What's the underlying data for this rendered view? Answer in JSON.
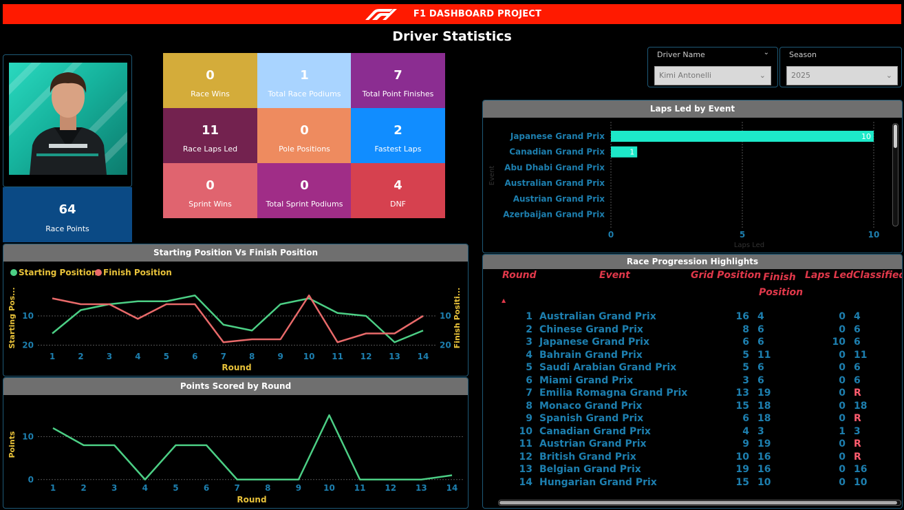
{
  "header": {
    "title": "F1 DASHBOARD PROJECT",
    "logo_icon": "f1-logo-icon",
    "color": "#ff1a00"
  },
  "page_title": "Driver Statistics",
  "race_points": {
    "value": "64",
    "label": "Race Points"
  },
  "kpis": [
    {
      "value": "0",
      "label": "Race Wins",
      "color": "#d4ac3a"
    },
    {
      "value": "1",
      "label": "Total Race Podiums",
      "color": "#a9d4ff"
    },
    {
      "value": "7",
      "label": "Total Point Finishes",
      "color": "#8b2d91"
    },
    {
      "value": "11",
      "label": "Race Laps Led",
      "color": "#73224f"
    },
    {
      "value": "0",
      "label": "Pole Positions",
      "color": "#ee8b5f"
    },
    {
      "value": "2",
      "label": "Fastest Laps",
      "color": "#118dff"
    },
    {
      "value": "0",
      "label": "Sprint Wins",
      "color": "#e0646f"
    },
    {
      "value": "0",
      "label": "Total Sprint Podiums",
      "color": "#a02d87"
    },
    {
      "value": "4",
      "label": "DNF",
      "color": "#d6414f"
    }
  ],
  "slicers": {
    "driver": {
      "title": "Driver Name",
      "value": "Kimi Antonelli"
    },
    "season": {
      "title": "Season",
      "value": "2025"
    }
  },
  "laps_led_panel": {
    "title": "Laps Led by Event"
  },
  "start_finish_panel": {
    "title": "Starting Position Vs Finish Position"
  },
  "points_panel": {
    "title": "Points Scored by Round"
  },
  "progression": {
    "title": "Race Progression Highlights",
    "columns": [
      "Round",
      "Event",
      "Grid Position",
      "Finish Position",
      "Laps Led",
      "Classified"
    ],
    "sort_indicator": "▲",
    "rows": [
      {
        "round": "1",
        "event": "Australian Grand Prix",
        "grid": "16",
        "finish": "4",
        "laps": "0",
        "classified": "4"
      },
      {
        "round": "2",
        "event": "Chinese Grand Prix",
        "grid": "8",
        "finish": "6",
        "laps": "0",
        "classified": "6"
      },
      {
        "round": "3",
        "event": "Japanese Grand Prix",
        "grid": "6",
        "finish": "6",
        "laps": "10",
        "classified": "6"
      },
      {
        "round": "4",
        "event": "Bahrain Grand Prix",
        "grid": "5",
        "finish": "11",
        "laps": "0",
        "classified": "11"
      },
      {
        "round": "5",
        "event": "Saudi Arabian Grand Prix",
        "grid": "5",
        "finish": "6",
        "laps": "0",
        "classified": "6"
      },
      {
        "round": "6",
        "event": "Miami Grand Prix",
        "grid": "3",
        "finish": "6",
        "laps": "0",
        "classified": "6"
      },
      {
        "round": "7",
        "event": "Emilia Romagna Grand Prix",
        "grid": "13",
        "finish": "19",
        "laps": "0",
        "classified": "R"
      },
      {
        "round": "8",
        "event": "Monaco Grand Prix",
        "grid": "15",
        "finish": "18",
        "laps": "0",
        "classified": "18"
      },
      {
        "round": "9",
        "event": "Spanish Grand Prix",
        "grid": "6",
        "finish": "18",
        "laps": "0",
        "classified": "R"
      },
      {
        "round": "10",
        "event": "Canadian Grand Prix",
        "grid": "4",
        "finish": "3",
        "laps": "1",
        "classified": "3"
      },
      {
        "round": "11",
        "event": "Austrian Grand Prix",
        "grid": "9",
        "finish": "19",
        "laps": "0",
        "classified": "R"
      },
      {
        "round": "12",
        "event": "British Grand Prix",
        "grid": "10",
        "finish": "16",
        "laps": "0",
        "classified": "R"
      },
      {
        "round": "13",
        "event": "Belgian Grand Prix",
        "grid": "19",
        "finish": "16",
        "laps": "0",
        "classified": "16"
      },
      {
        "round": "14",
        "event": "Hungarian Grand Prix",
        "grid": "15",
        "finish": "10",
        "laps": "0",
        "classified": "10"
      }
    ]
  },
  "chart_data": [
    {
      "type": "bar",
      "orientation": "horizontal",
      "title": "Laps Led by Event",
      "categories": [
        "Japanese Grand Prix",
        "Canadian Grand Prix",
        "Abu Dhabi Grand Prix",
        "Australian Grand Prix",
        "Austrian Grand Prix",
        "Azerbaijan Grand Prix"
      ],
      "values": [
        10,
        1,
        0,
        0,
        0,
        0
      ],
      "xlabel": "Laps Led",
      "ylabel": "Event",
      "xlim": [
        0,
        10
      ],
      "xticks": [
        0,
        5,
        10
      ],
      "color": "#1de9c9",
      "grid": true
    },
    {
      "type": "line",
      "title": "Starting Position Vs Finish Position",
      "x": [
        1,
        2,
        3,
        4,
        5,
        6,
        7,
        8,
        9,
        10,
        11,
        12,
        13,
        14
      ],
      "series": [
        {
          "name": "Starting Position",
          "values": [
            16,
            8,
            6,
            5,
            5,
            3,
            13,
            15,
            6,
            4,
            9,
            10,
            19,
            15
          ],
          "color": "#4ccf85",
          "axis": "left"
        },
        {
          "name": "Finish Position",
          "values": [
            4,
            6,
            6,
            11,
            6,
            6,
            19,
            18,
            18,
            3,
            19,
            16,
            16,
            10
          ],
          "color": "#e96a6a",
          "axis": "right"
        }
      ],
      "xlabel": "Round",
      "ylabel": "Starting Pos...",
      "ylabel_right": "Finish Positi...",
      "yticks": [
        10,
        20
      ],
      "ylim": [
        22,
        2
      ],
      "legend": "top-left"
    },
    {
      "type": "line",
      "title": "Points Scored by Round",
      "x": [
        1,
        2,
        3,
        4,
        5,
        6,
        7,
        8,
        9,
        10,
        11,
        12,
        13,
        14
      ],
      "series": [
        {
          "values": [
            12,
            8,
            8,
            0,
            8,
            8,
            0,
            0,
            0,
            15,
            0,
            0,
            0,
            1
          ],
          "color": "#4ccf85"
        }
      ],
      "xlabel": "Round",
      "ylabel": "Points",
      "yticks": [
        0,
        10
      ],
      "ylim": [
        -1,
        16
      ]
    }
  ]
}
